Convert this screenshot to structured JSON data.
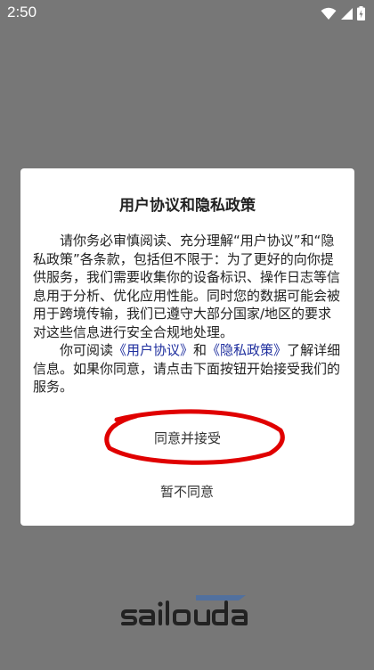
{
  "status_bar": {
    "time": "2:50",
    "icons": [
      "wifi-icon",
      "signal-icon",
      "battery-icon"
    ]
  },
  "dialog": {
    "title": "用户协议和隐私政策",
    "paragraph1": "请你务必审慎阅读、充分理解“用户协议”和“隐私政策”各条款，包括但不限于：为了更好的向你提供服务，我们需要收集你的设备标识、操作日志等信息用于分析、优化应用性能。同时您的数据可能会被用于跨境传输，我们已遵守大部分国家/地区的要求对这些信息进行安全合规地处理。",
    "paragraph2_prefix": "你可阅读",
    "user_agreement_link": "《用户协议》",
    "paragraph2_and": "和",
    "privacy_policy_link": "《隐私政策》",
    "paragraph2_suffix": "了解详细信息。如果你同意，请点击下面按钮开始接受我们的服务。",
    "accept_label": "同意并接受",
    "decline_label": "暂不同意"
  },
  "colors": {
    "overlay": "#777777",
    "link": "#1f2f9e",
    "highlight_circle": "#e00000"
  }
}
